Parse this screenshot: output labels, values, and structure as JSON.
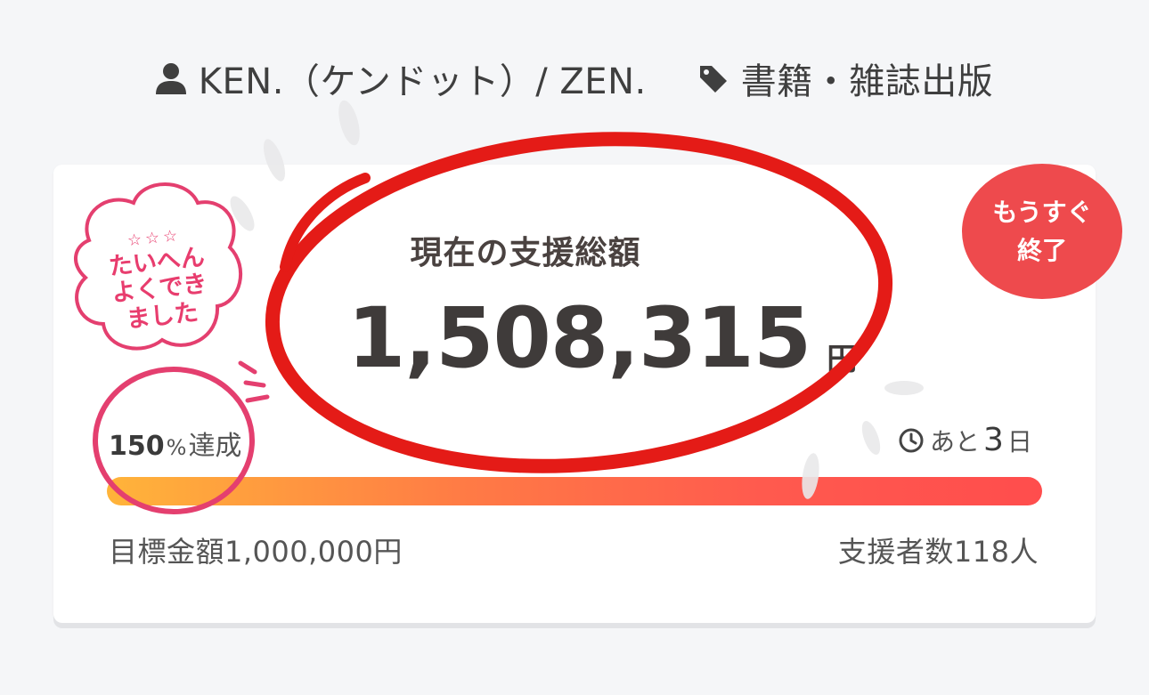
{
  "header": {
    "author": "KEN.（ケンドット）/ ZEN.",
    "category": "書籍・雑誌出版",
    "author_icon": "person-icon",
    "category_icon": "tag-icon"
  },
  "funding": {
    "total_label": "現在の支援総額",
    "total_amount": "1,508,315",
    "total_unit": "円",
    "achievement_number": "150",
    "achievement_percent": "%",
    "achievement_suffix": "達成",
    "remaining_prefix": "あと",
    "remaining_days": "3",
    "remaining_unit": "日",
    "clock_icon": "clock-icon",
    "progress_percent": 150,
    "goal_text": "目標金額1,000,000円",
    "backers_text": "支援者数118人"
  },
  "badge": {
    "line1": "もうすぐ",
    "line2": "終了",
    "color": "#ee4a4d"
  },
  "sticker": {
    "stars": "☆☆☆",
    "line1": "たいへん",
    "line2": "よくでき",
    "line3": "ました",
    "color": "#e83d6e"
  },
  "colors": {
    "annotation_red": "#e41b17",
    "bar_start": "#ffb43a",
    "bar_end": "#ff4d4d"
  }
}
